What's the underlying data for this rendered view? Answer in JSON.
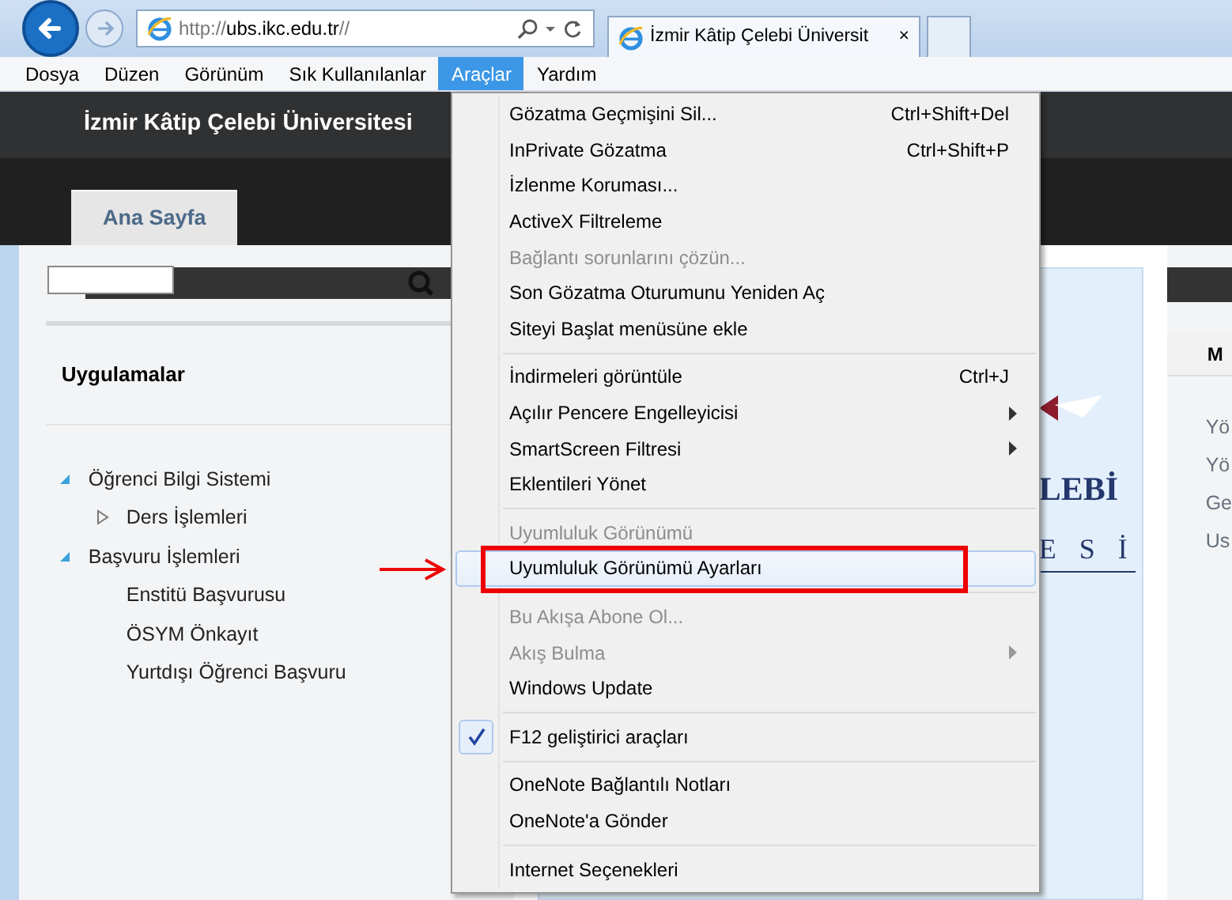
{
  "browser": {
    "address": {
      "prefix": "http://",
      "host": "ubs.ikc.edu.tr",
      "suffix": "//"
    },
    "tab": {
      "title": "İzmir Kâtip Çelebi Üniversit",
      "close": "×"
    }
  },
  "menubar": [
    {
      "label": "Dosya",
      "selected": false
    },
    {
      "label": "Düzen",
      "selected": false
    },
    {
      "label": "Görünüm",
      "selected": false
    },
    {
      "label": "Sık Kullanılanlar",
      "selected": false
    },
    {
      "label": "Araçlar",
      "selected": true
    },
    {
      "label": "Yardım",
      "selected": false
    }
  ],
  "page": {
    "site_title": "İzmir Kâtip Çelebi Üniversitesi",
    "nav_tab": "Ana Sayfa",
    "sidebar": {
      "heading": "Uygulamalar",
      "tree": [
        {
          "label": "Öğrenci Bilgi Sistemi",
          "expanded": true,
          "children": [
            {
              "label": "Ders İşlemleri",
              "expanded": false
            }
          ]
        },
        {
          "label": "Başvuru İşlemleri",
          "expanded": true,
          "children": [
            {
              "label": "Enstitü Başvurusu"
            },
            {
              "label": "ÖSYM Önkayıt"
            },
            {
              "label": "Yurtdışı Öğrenci Başvuru"
            }
          ]
        }
      ]
    },
    "logo_text": [
      "LEBİ",
      "E S İ"
    ],
    "right_panel": {
      "heading": "M",
      "items": [
        "Yö",
        "Yö",
        "Ge",
        "Us"
      ]
    }
  },
  "tools_menu": [
    {
      "kind": "item",
      "label": "Gözatma Geçmişini Sil...",
      "shortcut": "Ctrl+Shift+Del",
      "disabled": false,
      "checked": false,
      "submenu": false,
      "selected": false
    },
    {
      "kind": "item",
      "label": "InPrivate Gözatma",
      "shortcut": "Ctrl+Shift+P",
      "disabled": false,
      "checked": false,
      "submenu": false,
      "selected": false
    },
    {
      "kind": "item",
      "label": "İzlenme Koruması...",
      "disabled": false,
      "checked": false,
      "submenu": false,
      "selected": false
    },
    {
      "kind": "item",
      "label": "ActiveX Filtreleme",
      "disabled": false,
      "checked": false,
      "submenu": false,
      "selected": false
    },
    {
      "kind": "item",
      "label": "Bağlantı sorunlarını çözün...",
      "disabled": true,
      "checked": false,
      "submenu": false,
      "selected": false
    },
    {
      "kind": "item",
      "label": "Son Gözatma Oturumunu Yeniden Aç",
      "disabled": false,
      "checked": false,
      "submenu": false,
      "selected": false
    },
    {
      "kind": "item",
      "label": "Siteyi Başlat menüsüne ekle",
      "disabled": false,
      "checked": false,
      "submenu": false,
      "selected": false
    },
    {
      "kind": "separator"
    },
    {
      "kind": "item",
      "label": "İndirmeleri görüntüle",
      "shortcut": "Ctrl+J",
      "disabled": false,
      "checked": false,
      "submenu": false,
      "selected": false
    },
    {
      "kind": "item",
      "label": "Açılır Pencere Engelleyicisi",
      "disabled": false,
      "checked": false,
      "submenu": true,
      "selected": false
    },
    {
      "kind": "item",
      "label": "SmartScreen Filtresi",
      "disabled": false,
      "checked": false,
      "submenu": true,
      "selected": false
    },
    {
      "kind": "item",
      "label": "Eklentileri Yönet",
      "disabled": false,
      "checked": false,
      "submenu": false,
      "selected": false
    },
    {
      "kind": "separator"
    },
    {
      "kind": "item",
      "label": "Uyumluluk Görünümü",
      "disabled": true,
      "checked": false,
      "submenu": false,
      "selected": false
    },
    {
      "kind": "item",
      "label": "Uyumluluk Görünümü Ayarları",
      "disabled": false,
      "checked": false,
      "submenu": false,
      "selected": true,
      "annotated": true
    },
    {
      "kind": "separator"
    },
    {
      "kind": "item",
      "label": "Bu Akışa Abone Ol...",
      "disabled": true,
      "checked": false,
      "submenu": false,
      "selected": false
    },
    {
      "kind": "item",
      "label": "Akış Bulma",
      "disabled": true,
      "checked": false,
      "submenu": true,
      "selected": false
    },
    {
      "kind": "item",
      "label": "Windows Update",
      "disabled": false,
      "checked": false,
      "submenu": false,
      "selected": false
    },
    {
      "kind": "separator"
    },
    {
      "kind": "item",
      "label": "F12 geliştirici araçları",
      "disabled": false,
      "checked": true,
      "submenu": false,
      "selected": false
    },
    {
      "kind": "separator"
    },
    {
      "kind": "item",
      "label": "OneNote Bağlantılı Notları",
      "disabled": false,
      "checked": false,
      "submenu": false,
      "selected": false
    },
    {
      "kind": "item",
      "label": "OneNote'a Gönder",
      "disabled": false,
      "checked": false,
      "submenu": false,
      "selected": false
    },
    {
      "kind": "separator"
    },
    {
      "kind": "item",
      "label": "Internet Seçenekleri",
      "disabled": false,
      "checked": false,
      "submenu": false,
      "selected": false
    }
  ]
}
